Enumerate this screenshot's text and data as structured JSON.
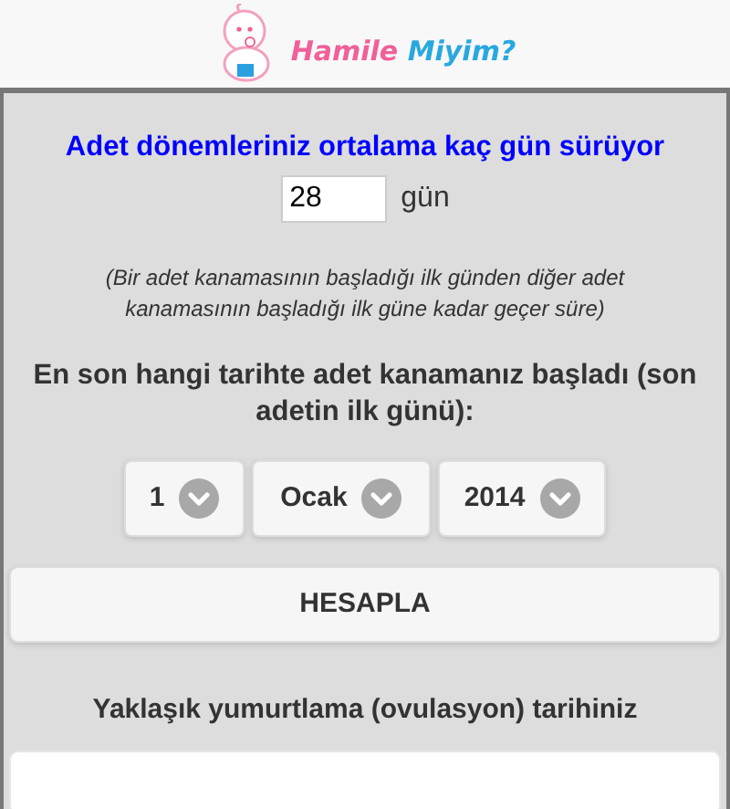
{
  "logo": {
    "word_1": "Hamile",
    "word_2": "Miyim?"
  },
  "cycle": {
    "question": "Adet dönemleriniz ortalama kaç gün sürüyor",
    "value": "28",
    "unit": "gün",
    "note": "(Bir adet kanamasının  başladığı ilk günden diğer adet kanamasının başladığı ilk güne kadar geçer süre)"
  },
  "last_period": {
    "question": "En son hangi tarihte adet kanamanız başladı (son adetin ilk günü):",
    "selects": [
      {
        "value": "1"
      },
      {
        "value": "Ocak"
      },
      {
        "value": "2014"
      }
    ]
  },
  "buttons": [
    "HESAPLA"
  ],
  "result": {
    "label": "Yaklaşık yumurtlama (ovulasyon) tarihiniz"
  }
}
